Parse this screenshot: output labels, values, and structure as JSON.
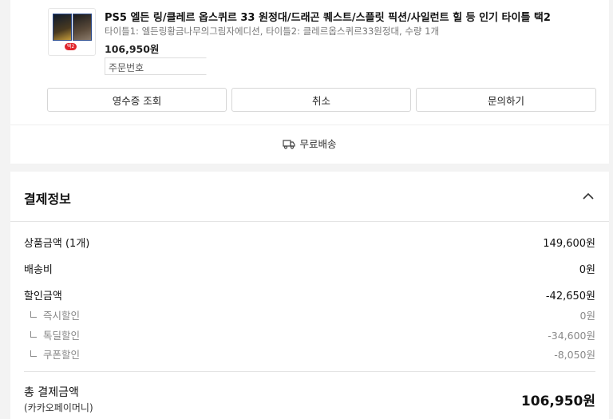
{
  "product": {
    "title": "PS5 엘든 링/클레르 옵스퀴르 33 원정대/드래곤 퀘스트/스플릿 픽션/사일런트 힐 등 인기 타이틀 택2",
    "option": "타이틀1: 엘든링황금나무의그림자에디션, 타이틀2: 클레르옵스퀴르33원정대, 수량 1개",
    "price": "106,950원",
    "thumb_tag": "택2",
    "order_number_label": "주문번호"
  },
  "actions": {
    "receipt": "영수증 조회",
    "cancel": "취소",
    "inquiry": "문의하기"
  },
  "shipping": {
    "label": "무료배송",
    "icon": "truck-icon"
  },
  "payment": {
    "header": "결제정보",
    "collapse_icon": "chevron-up-icon",
    "rows": [
      {
        "label": "상품금액 (1개)",
        "value": "149,600원"
      },
      {
        "label": "배송비",
        "value": "0원"
      },
      {
        "label": "할인금액",
        "value": "-42,650원"
      }
    ],
    "discounts": [
      {
        "label": "즉시할인",
        "value": "0원"
      },
      {
        "label": "톡딜할인",
        "value": "-34,600원"
      },
      {
        "label": "쿠폰할인",
        "value": "-8,050원"
      }
    ],
    "total_label": "총 결제금액",
    "total_method": "(카카오페이머니)",
    "total_value": "106,950원"
  }
}
